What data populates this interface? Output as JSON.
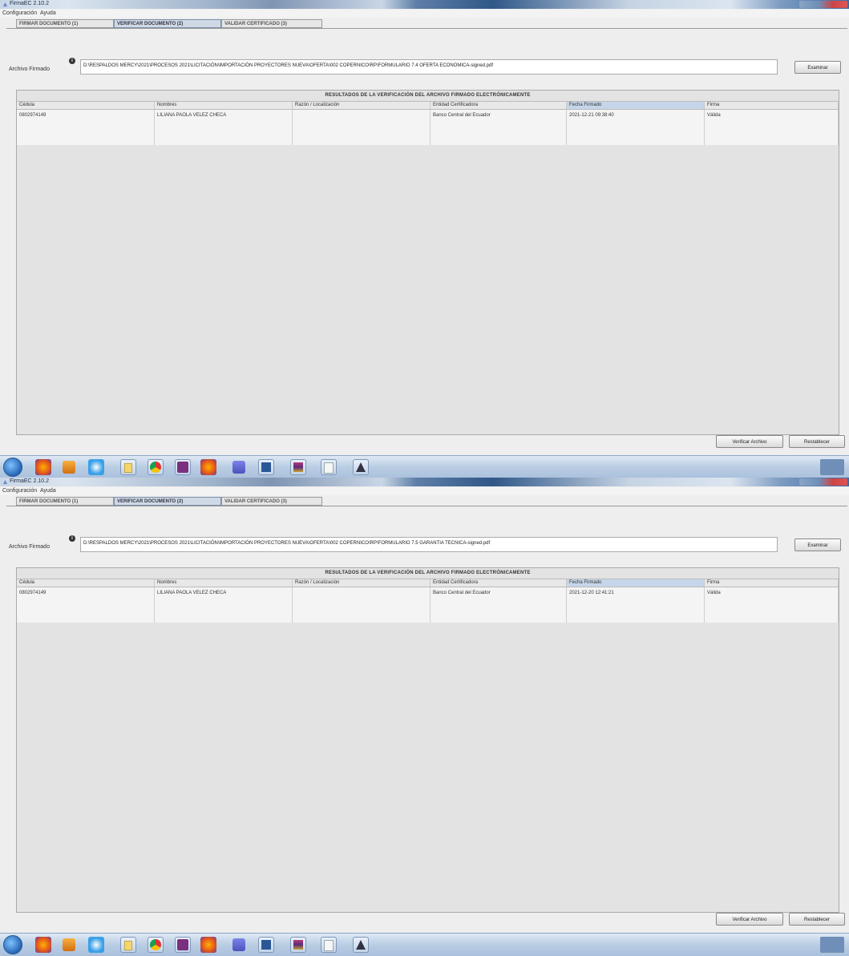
{
  "windows": [
    {
      "app_title": "FirmaEC 2.10.2",
      "menu": [
        "Configuración",
        "Ayuda"
      ],
      "tabs": [
        "FIRMAR DOCUMENTO (1)",
        "VERIFICAR DOCUMENTO (2)",
        "VALIDAR CERTIFICADO (3)"
      ],
      "active_tab": "VERIFICAR DOCUMENTO (2)",
      "file_label": "Archivo Firmado",
      "file_path": "D:\\RESPALDOS MERCY\\2021\\PROCESOS 2021\\LICITACIÓN\\IMPORTACIÓN PROYECTORES NUEVA\\OFERTA\\002 COPERNICO\\RP\\FORMULARIO 7.4 OFERTA ECONOMICA-signed.pdf",
      "examine_button": "Examinar",
      "results_title": "RESULTADOS DE LA VERIFICACIÓN DEL ARCHIVO FIRMADO ELECTRÓNICAMENTE",
      "columns": [
        "Cédula",
        "Nombres",
        "Razón / Localización",
        "Entidad Certificadora",
        "Fecha Firmado",
        "Firma"
      ],
      "sorted_column": "Fecha Firmado",
      "rows": [
        {
          "cedula": "0802974149",
          "nombres": "LILIANA PAOLA VELEZ CHECA",
          "razon": "",
          "entidad": "Banco Central del Ecuador",
          "fecha": "2021-12-21 09:38:40",
          "firma": "Válida"
        }
      ],
      "verify_button": "Verificar Archivo",
      "reset_button": "Restablecer"
    },
    {
      "app_title": "FirmaEC 2.10.2",
      "menu": [
        "Configuración",
        "Ayuda"
      ],
      "tabs": [
        "FIRMAR DOCUMENTO (1)",
        "VERIFICAR DOCUMENTO (2)",
        "VALIDAR CERTIFICADO (3)"
      ],
      "active_tab": "VERIFICAR DOCUMENTO (2)",
      "file_label": "Archivo Firmado",
      "file_path": "D:\\RESPALDOS MERCY\\2021\\PROCESOS 2021\\LICITACIÓN\\IMPORTACIÓN PROYECTORES NUEVA\\OFERTA\\002 COPERNICO\\RP\\FORMULARIO 7.5 GARANTIA TECNICA-signed.pdf",
      "examine_button": "Examinar",
      "results_title": "RESULTADOS DE LA VERIFICACIÓN DEL ARCHIVO FIRMADO ELECTRÓNICAMENTE",
      "columns": [
        "Cédula",
        "Nombres",
        "Razón / Localización",
        "Entidad Certificadora",
        "Fecha Firmado",
        "Firma"
      ],
      "sorted_column": "Fecha Firmado",
      "rows": [
        {
          "cedula": "0802974149",
          "nombres": "LILIANA PAOLA VELEZ CHECA",
          "razon": "",
          "entidad": "Banco Central del Ecuador",
          "fecha": "2021-12-20 12:41:21",
          "firma": "Válida"
        }
      ],
      "verify_button": "Verificar Archivo",
      "reset_button": "Restablecer"
    }
  ],
  "taskbar": {
    "icons": [
      "windows-start-icon",
      "firefox-icon",
      "media-player-icon",
      "internet-explorer-icon",
      "file-explorer-icon",
      "chrome-icon",
      "app-g-icon",
      "firefox-icon",
      "teams-icon",
      "word-icon",
      "winrar-icon",
      "notepad-icon",
      "firmaec-icon"
    ]
  },
  "colors": {
    "titlebar": "#2f5788",
    "tab_active": "#cfd9e6",
    "sorted_header": "#c6d6ea",
    "window_bg": "#eeeeee"
  }
}
